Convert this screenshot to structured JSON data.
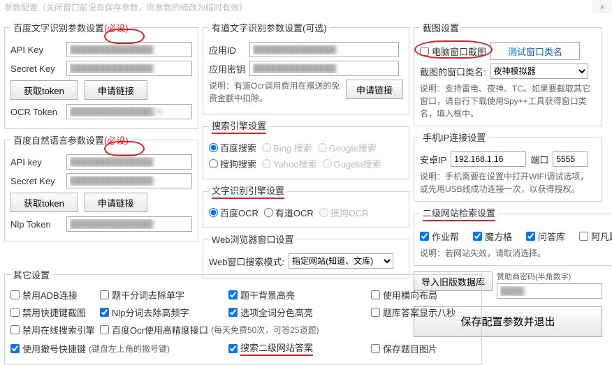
{
  "window": {
    "title": "参数配置（关闭窗口前没有保存参数，则参数的修改为临时有效）",
    "close": "×"
  },
  "baidu_ocr": {
    "legend": "百度文字识别参数设置",
    "legend_mark": "(必设)",
    "api_key_label": "API Key",
    "api_key_value": "██████████████",
    "secret_key_label": "Secret Key",
    "secret_key_value": "██████████████",
    "get_token": "获取token",
    "apply_link": "申请链接",
    "ocr_token_label": "OCR Token",
    "ocr_token_value": "██████████████28"
  },
  "baidu_nlp": {
    "legend": "百度自然语言参数设置",
    "legend_mark": "(必设)",
    "api_key_label": "API key",
    "api_key_value": "██████████████",
    "secret_key_label": "Secret Key",
    "secret_key_value": "██████████████",
    "get_token": "获取token",
    "apply_link": "申请链接",
    "nlp_token_label": "Nlp Token",
    "nlp_token_value": "██████████████"
  },
  "youdao": {
    "legend": "有道文字识别参数设置(可选)",
    "app_id_label": "应用ID",
    "app_id_value": "██████████████",
    "app_key_label": "应用密钥",
    "app_key_value": "██████████████",
    "note": "说明：有道Ocr调用费用在赠送的免费金额中扣除。",
    "apply_link": "申请链接"
  },
  "search_engine": {
    "legend": "搜索引擎设置",
    "baidu": "百度搜索",
    "bing": "Bing 搜索",
    "google": "Google搜索",
    "sogou": "搜狗搜索",
    "yahoo": "Yahoo搜索",
    "gugela": "Gugela搜索"
  },
  "ocr_engine": {
    "legend": "文字识别引擎设置",
    "baidu": "百度OCR",
    "youdao": "有道OCR",
    "sogou": "搜狗OCR"
  },
  "web_browser": {
    "legend": "Web浏览器窗口设置",
    "mode_label": "Web窗口搜索模式:",
    "mode_value": "指定网站(知道、文库)"
  },
  "screenshot": {
    "legend": "截图设置",
    "window_capture": "电脑窗口截图",
    "test_btn": "测试窗口类名",
    "class_label": "截图的窗口类名:",
    "class_value": "夜神模拟器",
    "note": "说明：支持雷电、夜神、TC。如果要截取其它窗口，请自行下载使用Spy++工具获得窗口类名，填入框中。"
  },
  "phone_ip": {
    "legend": "手机IP连接设置",
    "ip_label": "安卓IP",
    "ip_value": "192.168.1.16",
    "port_label": "端口",
    "port_value": "5555",
    "note": "说明：手机需要在设置中打开WIFI调试选项，或先用USB线成功连接一次，以获得授权。"
  },
  "secondary_site": {
    "legend": "二级网站检索设置",
    "zuoyebang": "作业帮",
    "mofangge": "魔方格",
    "wendaku": "问答库",
    "afanti": "阿凡题",
    "note": "说明：若网站失效，请取消选择。"
  },
  "misc": {
    "legend": "其它设置",
    "adb": "禁用ADB连接",
    "hotkey_shot": "禁用快捷键截图",
    "online_search": "禁用在线搜索引擎",
    "undo_hotkey": "使用撤号快捷键",
    "undo_hotkey_paren": "(键盘左上角的撤号键)",
    "q_remove_word": "题干分词去除单字",
    "nlp_remove_high": "Nlp分词去除高频字",
    "baidu_high_precision": "百度Ocr使用高精度接口",
    "high_precision_paren": "(每天免费50次，可答25道题)",
    "q_bg_highlight": "题干背景高亮",
    "option_color_highlight": "选项全词分色高亮",
    "search_secondary": "搜索二级网站答案",
    "horizontal_layout": "使用横向布局",
    "answer_8s": "题库答案显示八秒",
    "save_question": "保存题目图片"
  },
  "bottom": {
    "import_db": "导入旧版数据库",
    "sponsor_label": "赞助商密码(半角数字)",
    "sponsor_value": "████",
    "save_exit": "保存配置参数并退出"
  }
}
